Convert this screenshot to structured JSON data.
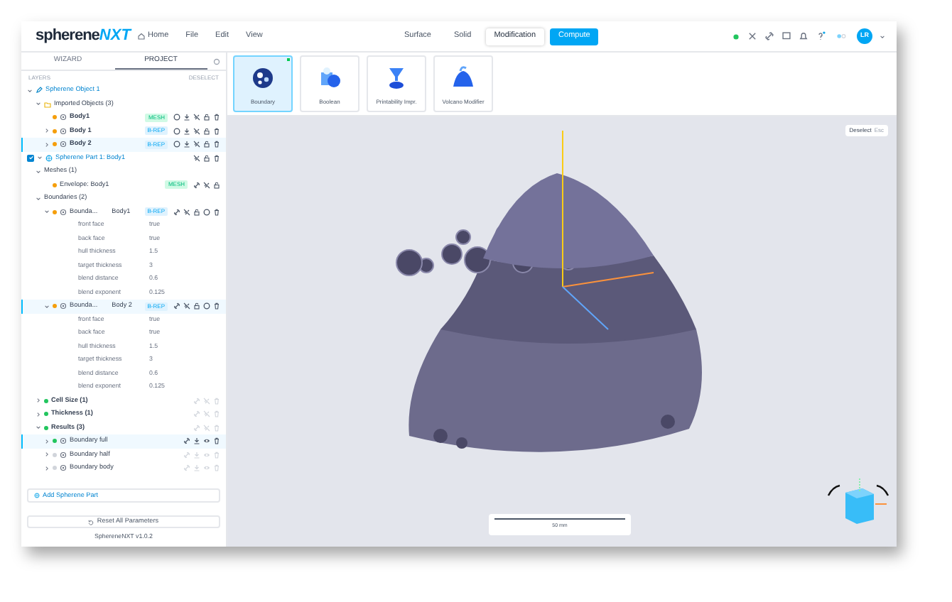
{
  "logo": {
    "wordmark": "spherene",
    "suffix": "NXT"
  },
  "menu": [
    {
      "label": "Home",
      "kind": "home"
    },
    {
      "label": "File",
      "kind": "plain"
    },
    {
      "label": "Edit",
      "kind": "plain"
    },
    {
      "label": "View",
      "kind": "plain"
    }
  ],
  "mode_tabs": [
    {
      "label": "Surface",
      "selected": false
    },
    {
      "label": "Solid",
      "selected": false
    },
    {
      "label": "Modification",
      "selected": true
    }
  ],
  "compute_button": "Compute",
  "user_avatar": "LR",
  "tools": [
    {
      "label": "Boundary",
      "kind": "boundary",
      "selected": true
    },
    {
      "label": "Boolean",
      "kind": "boolean",
      "selected": false
    },
    {
      "label": "Printability Impr.",
      "kind": "printability",
      "selected": false
    },
    {
      "label": "Volcano Modifier",
      "kind": "volcano",
      "selected": false
    }
  ],
  "panel_tabs": [
    {
      "label": "WIZARD",
      "selected": false
    },
    {
      "label": "PROJECT",
      "selected": true
    }
  ],
  "layers_label": "LAYERS",
  "deselect_link": "DESELECT",
  "tree": [
    {
      "label": "Spherene Object 1",
      "kind": "object",
      "expanded": true,
      "selected": false,
      "children": [
        {
          "label": "Imported Objects (3)",
          "kind": "folder",
          "expanded": true,
          "selected": false,
          "children": [
            {
              "label": "Body1",
              "kind": "body",
              "color": "#f59e0b",
              "badge": "MESH",
              "selected": false
            },
            {
              "label": "Body 1",
              "kind": "body",
              "color": "#f59e0b",
              "badge": "B-REP",
              "expanded": false,
              "selected": false
            },
            {
              "label": "Body 2",
              "kind": "body",
              "color": "#f59e0b",
              "badge": "B-REP",
              "expanded": false,
              "selected": true
            }
          ]
        }
      ]
    },
    {
      "label": "Spherene Part 1: Body1",
      "kind": "part",
      "expanded": true,
      "checked": true,
      "selected": false,
      "children": [
        {
          "label": "Meshes (1)",
          "kind": "group",
          "expanded": true,
          "selected": false,
          "children": [
            {
              "label": "Envelope: Body1",
              "kind": "mesh",
              "color": "#f59e0b",
              "badge": "MESH",
              "selected": false
            }
          ]
        },
        {
          "label": "Boundaries (2)",
          "kind": "group",
          "expanded": true,
          "selected": false,
          "children": [
            {
              "label": "Bounda...",
              "label_2": "Body1",
              "kind": "boundary",
              "color": "#f59e0b",
              "badge": "B-REP",
              "expanded": true,
              "selected": false,
              "properties": [
                {
                  "name": "front face",
                  "value": "true"
                },
                {
                  "name": "back face",
                  "value": "true"
                },
                {
                  "name": "hull thickness",
                  "value": "1.5"
                },
                {
                  "name": "target thickness",
                  "value": "3"
                },
                {
                  "name": "blend distance",
                  "value": "0.6"
                },
                {
                  "name": "blend exponent",
                  "value": "0.125"
                }
              ]
            },
            {
              "label": "Bounda...",
              "label_2": "Body 2",
              "kind": "boundary",
              "color": "#f59e0b",
              "badge": "B-REP",
              "expanded": true,
              "selected": true,
              "properties": [
                {
                  "name": "front face",
                  "value": "true"
                },
                {
                  "name": "back face",
                  "value": "true"
                },
                {
                  "name": "hull thickness",
                  "value": "1.5"
                },
                {
                  "name": "target thickness",
                  "value": "3"
                },
                {
                  "name": "blend distance",
                  "value": "0.6"
                },
                {
                  "name": "blend exponent",
                  "value": "0.125"
                }
              ]
            }
          ]
        },
        {
          "label": "Cell Size (1)",
          "kind": "param",
          "color": "#22c55e",
          "expanded": false,
          "selected": false
        },
        {
          "label": "Thickness (1)",
          "kind": "param",
          "color": "#22c55e",
          "expanded": false,
          "selected": false
        },
        {
          "label": "Results (3)",
          "kind": "param",
          "color": "#22c55e",
          "expanded": true,
          "selected": false,
          "children": [
            {
              "label": "Boundary full",
              "kind": "result",
              "color": "#22c55e",
              "expanded": false,
              "selected": true
            },
            {
              "label": "Boundary half",
              "kind": "result",
              "color": "#d1d5db",
              "expanded": false,
              "selected": false
            },
            {
              "label": "Boundary body",
              "kind": "result",
              "color": "#d1d5db",
              "expanded": false,
              "selected": false
            }
          ]
        }
      ]
    }
  ],
  "add_part_link": "Add Spherene Part",
  "reset_button": "Reset All Parameters",
  "version": "SphereneNXT v1.0.2",
  "deselect_button": {
    "label": "Deselect",
    "shortcut": "Esc"
  },
  "scale_bar": "50 mm"
}
